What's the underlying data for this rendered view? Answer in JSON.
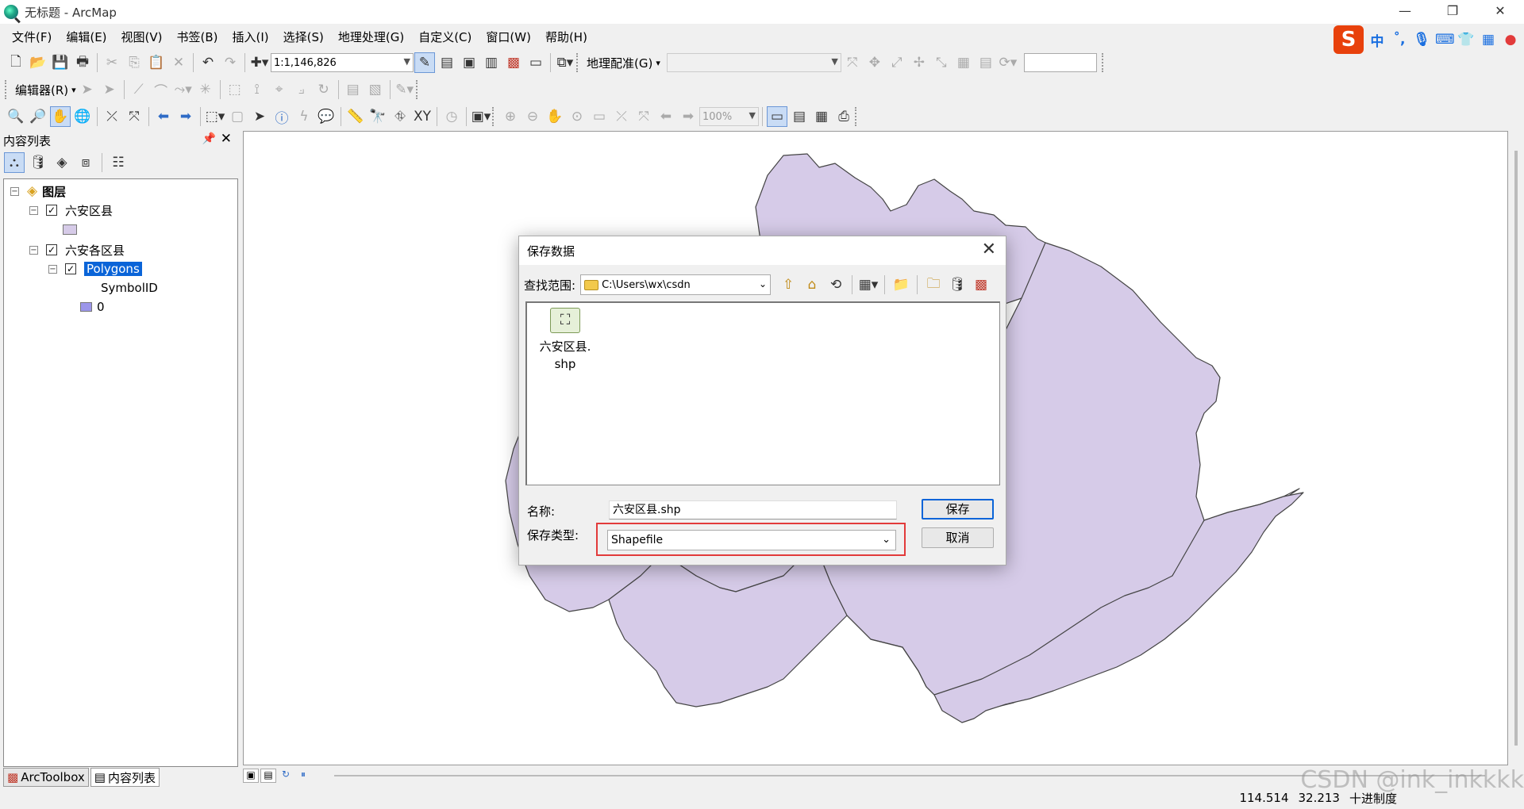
{
  "window": {
    "title": "无标题 - ArcMap"
  },
  "menubar": [
    "文件(F)",
    "编辑(E)",
    "视图(V)",
    "书签(B)",
    "插入(I)",
    "选择(S)",
    "地理处理(G)",
    "自定义(C)",
    "窗口(W)",
    "帮助(H)"
  ],
  "ime": {
    "logo": "S",
    "lang": "中"
  },
  "toolbar_standard": {
    "scale": "1:1,146,826",
    "georef_label": "地理配准(G)"
  },
  "toolbar_editor": {
    "label": "编辑器(R)"
  },
  "toolbar_tools": {
    "zoom": "100%"
  },
  "toc": {
    "title": "内容列表",
    "root": "图层",
    "layers": [
      {
        "name": "六安区县",
        "checked": true,
        "color": "#d6cbe8"
      },
      {
        "name": "六安各区县",
        "checked": true,
        "sublayer": "Polygons",
        "field": "SymbolID",
        "class_value": "0",
        "class_color": "#9c96ea"
      }
    ]
  },
  "bottom_tabs": [
    "ArcToolbox",
    "内容列表"
  ],
  "status": {
    "x": "114.514",
    "y": "32.213",
    "units": "十进制度"
  },
  "watermark": "CSDN @ink_inkkkk",
  "map": {
    "fill": "#d6cbe8",
    "stroke": "#444"
  },
  "dialog": {
    "title": "保存数据",
    "look_in_label": "查找范围:",
    "look_in_path": "C:\\Users\\wx\\csdn",
    "files": [
      {
        "name_line1": "六安区县.",
        "name_line2": "shp"
      }
    ],
    "name_label": "名称:",
    "name_value": "六安区县.shp",
    "type_label": "保存类型:",
    "type_value": "Shapefile",
    "save_button": "保存",
    "cancel_button": "取消"
  }
}
